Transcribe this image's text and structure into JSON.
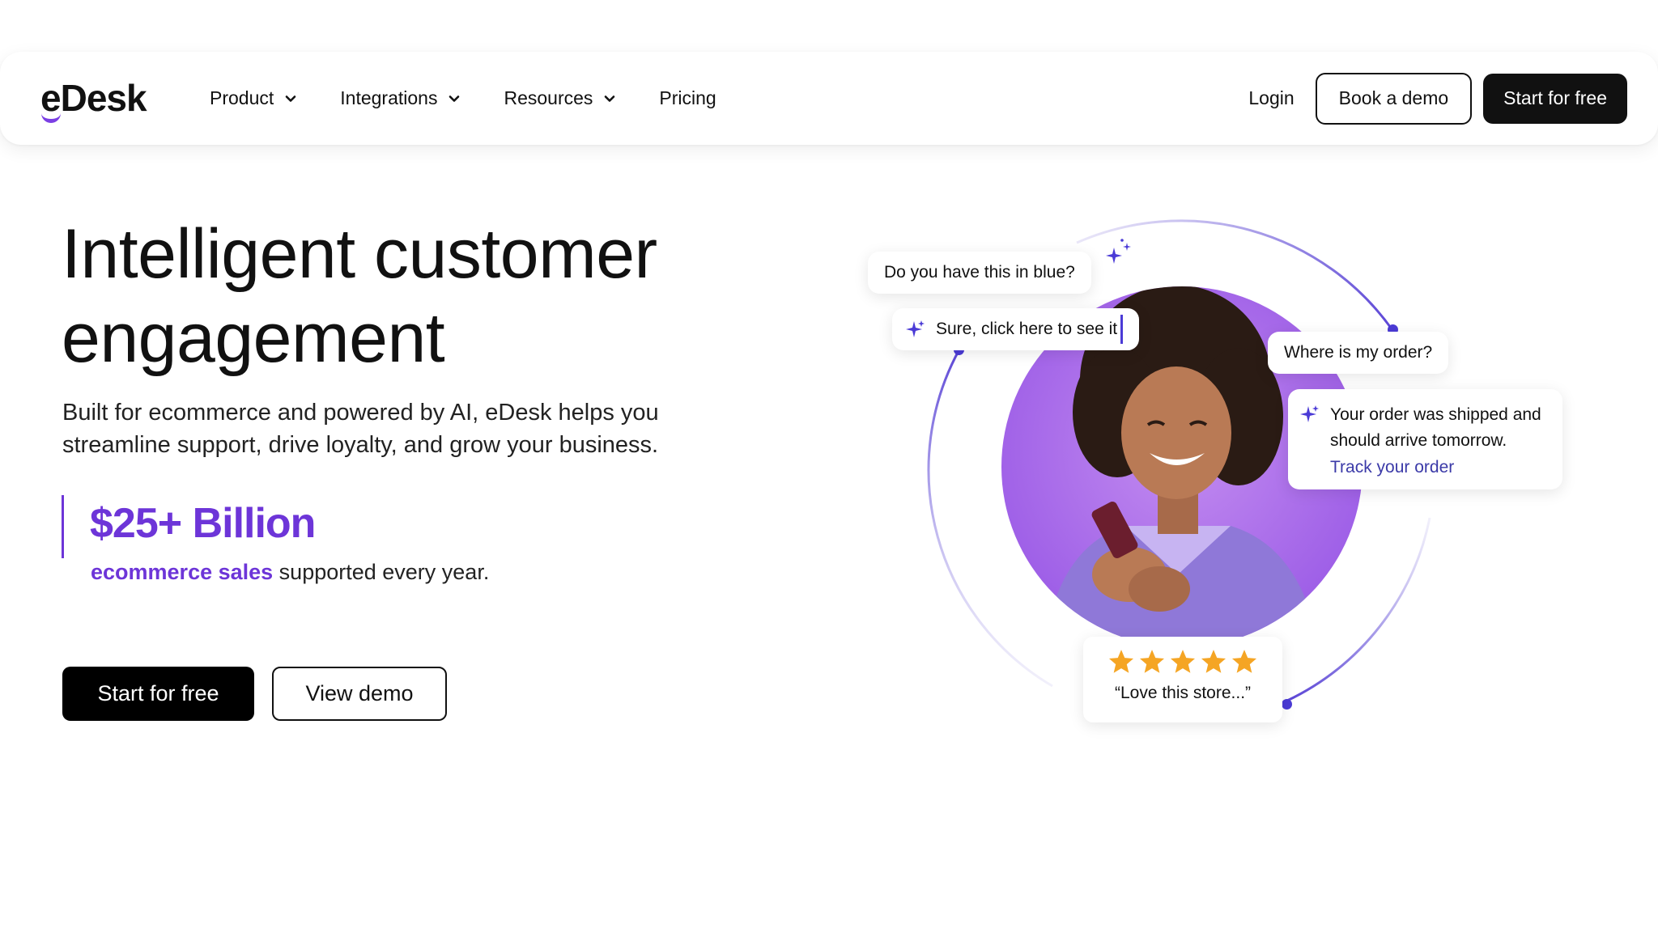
{
  "nav": {
    "logo": "eDesk",
    "logo_first_letter": "e",
    "logo_rest": "Desk",
    "items": [
      {
        "label": "Product",
        "has_dropdown": true
      },
      {
        "label": "Integrations",
        "has_dropdown": true
      },
      {
        "label": "Resources",
        "has_dropdown": true
      },
      {
        "label": "Pricing",
        "has_dropdown": false
      }
    ],
    "login": "Login",
    "book_demo": "Book a demo",
    "start_free": "Start for free"
  },
  "hero": {
    "title_line1": "Intelligent customer",
    "title_line2": "engagement",
    "subtitle_line1": "Built for ecommerce and powered by AI, eDesk helps you",
    "subtitle_line2": "streamline support, drive loyalty, and grow your business.",
    "stat_value": "$25+ Billion",
    "stat_highlight": "ecommerce sales",
    "stat_rest": " supported every year.",
    "cta_primary": "Start for free",
    "cta_secondary": "View demo"
  },
  "illustration": {
    "question_1": "Do you have this in blue?",
    "answer_1": "Sure, click here to see it",
    "question_2": "Where is my order?",
    "answer_2_line1": "Your order was shipped and",
    "answer_2_line2": "should arrive tomorrow.",
    "answer_2_link": "Track your order",
    "review_stars": 5,
    "review_quote": "“Love this store...”"
  },
  "colors": {
    "brand_purple": "#6d35d8",
    "accent_indigo": "#4b3bd6",
    "star_orange": "#f5a524",
    "link_blue": "#3b3aa8",
    "dark": "#111111"
  }
}
